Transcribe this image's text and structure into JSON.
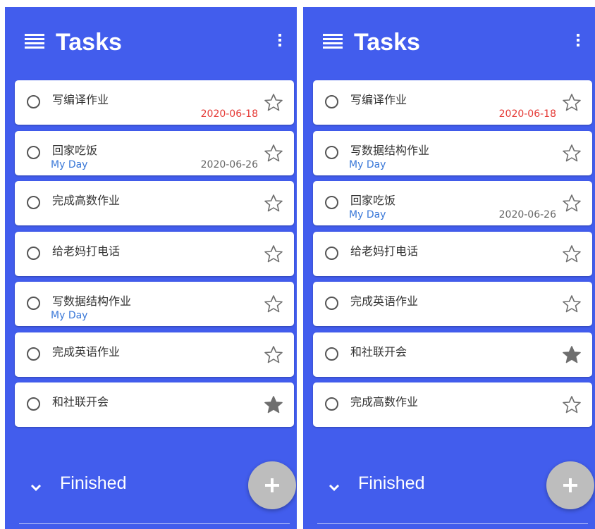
{
  "colors": {
    "background": "#425ded",
    "card": "#ffffff",
    "accent_myday": "#3a78d8",
    "overdue": "#e53935",
    "fab": "#bdbdbd"
  },
  "left": {
    "header": {
      "title": "Tasks",
      "menu_icon": "hamburger-icon",
      "more_icon": "more-vert-icon"
    },
    "tasks": [
      {
        "title": "写编译作业",
        "myday": "",
        "due": "2020-06-18",
        "overdue": true,
        "starred": false
      },
      {
        "title": "回家吃饭",
        "myday": "My Day",
        "due": "2020-06-26",
        "overdue": false,
        "starred": false
      },
      {
        "title": "完成高数作业",
        "myday": "",
        "due": "",
        "overdue": false,
        "starred": false
      },
      {
        "title": "给老妈打电话",
        "myday": "",
        "due": "",
        "overdue": false,
        "starred": false
      },
      {
        "title": "写数据结构作业",
        "myday": "My Day",
        "due": "",
        "overdue": false,
        "starred": false
      },
      {
        "title": "完成英语作业",
        "myday": "",
        "due": "",
        "overdue": false,
        "starred": false
      },
      {
        "title": "和社联开会",
        "myday": "",
        "due": "",
        "overdue": false,
        "starred": true
      }
    ],
    "finished": {
      "label": "Finished",
      "icon": "chevron-down-icon"
    },
    "fab": {
      "icon": "plus-icon"
    }
  },
  "right": {
    "header": {
      "title": "Tasks",
      "menu_icon": "hamburger-icon",
      "more_icon": "more-vert-icon"
    },
    "tasks": [
      {
        "title": "写编译作业",
        "myday": "",
        "due": "2020-06-18",
        "overdue": true,
        "starred": false
      },
      {
        "title": "写数据结构作业",
        "myday": "My Day",
        "due": "",
        "overdue": false,
        "starred": false
      },
      {
        "title": "回家吃饭",
        "myday": "My Day",
        "due": "2020-06-26",
        "overdue": false,
        "starred": false
      },
      {
        "title": "给老妈打电话",
        "myday": "",
        "due": "",
        "overdue": false,
        "starred": false
      },
      {
        "title": "完成英语作业",
        "myday": "",
        "due": "",
        "overdue": false,
        "starred": false
      },
      {
        "title": "和社联开会",
        "myday": "",
        "due": "",
        "overdue": false,
        "starred": true
      },
      {
        "title": "完成高数作业",
        "myday": "",
        "due": "",
        "overdue": false,
        "starred": false
      }
    ],
    "finished": {
      "label": "Finished",
      "icon": "chevron-down-icon"
    },
    "fab": {
      "icon": "plus-icon"
    }
  }
}
